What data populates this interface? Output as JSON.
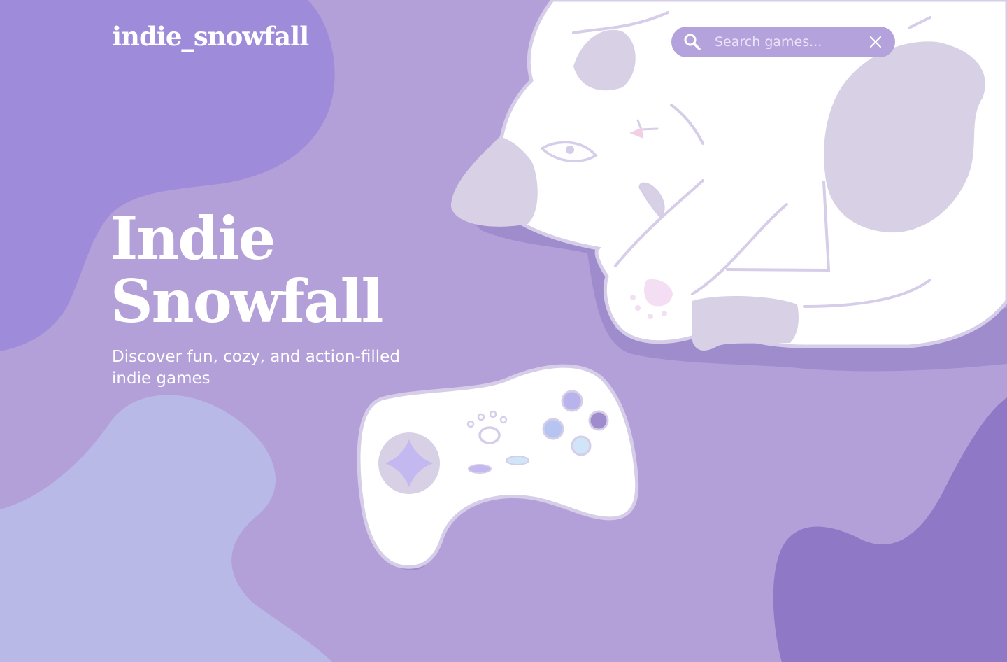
{
  "brand": {
    "logo_text": "indie_snowfall"
  },
  "search": {
    "placeholder": "Search games...",
    "value": ""
  },
  "hero": {
    "title_line1": "Indie",
    "title_line2": "Snowfall",
    "subtitle": "Discover fun, cozy, and action-filled indie games"
  },
  "icons": {
    "search": "search-icon",
    "clear": "close-icon"
  },
  "colors": {
    "background": "#b3a0d8",
    "blob_top_left": "#9e8bda",
    "blob_bottom_left": "#b8b9e6",
    "blob_bottom_right": "#8f78c5",
    "illustration_white": "#ffffff",
    "illustration_shade": "#d8d1e6",
    "text": "#ffffff"
  }
}
